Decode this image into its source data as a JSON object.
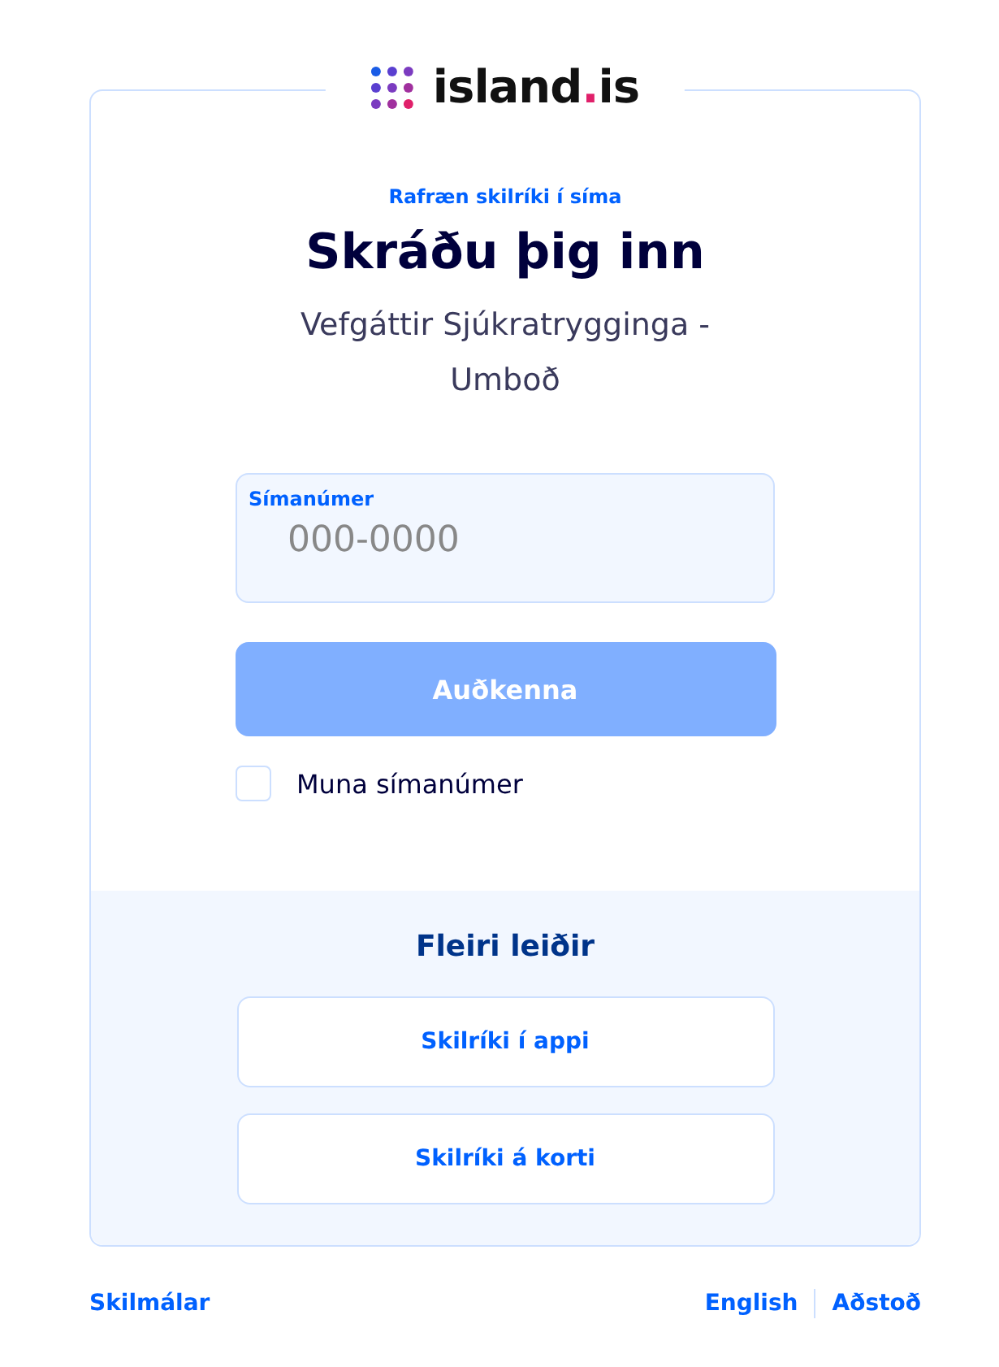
{
  "logo": {
    "word": "island",
    "dot": ".",
    "suffix": "is"
  },
  "eyebrow": "Rafræn skilríki í síma",
  "title": "Skráðu þig inn",
  "subtitle": "Vefgáttir Sjúkratrygginga - Umboð",
  "phone_field": {
    "label": "Símanúmer",
    "placeholder": "000-0000"
  },
  "submit": {
    "label": "Auðkenna",
    "disabled": true
  },
  "remember": {
    "label": "Muna símanúmer",
    "checked": false
  },
  "alternatives": {
    "heading": "Fleiri leiðir",
    "buttons": [
      "Skilríki í appi",
      "Skilríki á korti"
    ]
  },
  "footer": {
    "left": "Skilmálar",
    "right": [
      "English",
      "Aðstoð"
    ]
  }
}
